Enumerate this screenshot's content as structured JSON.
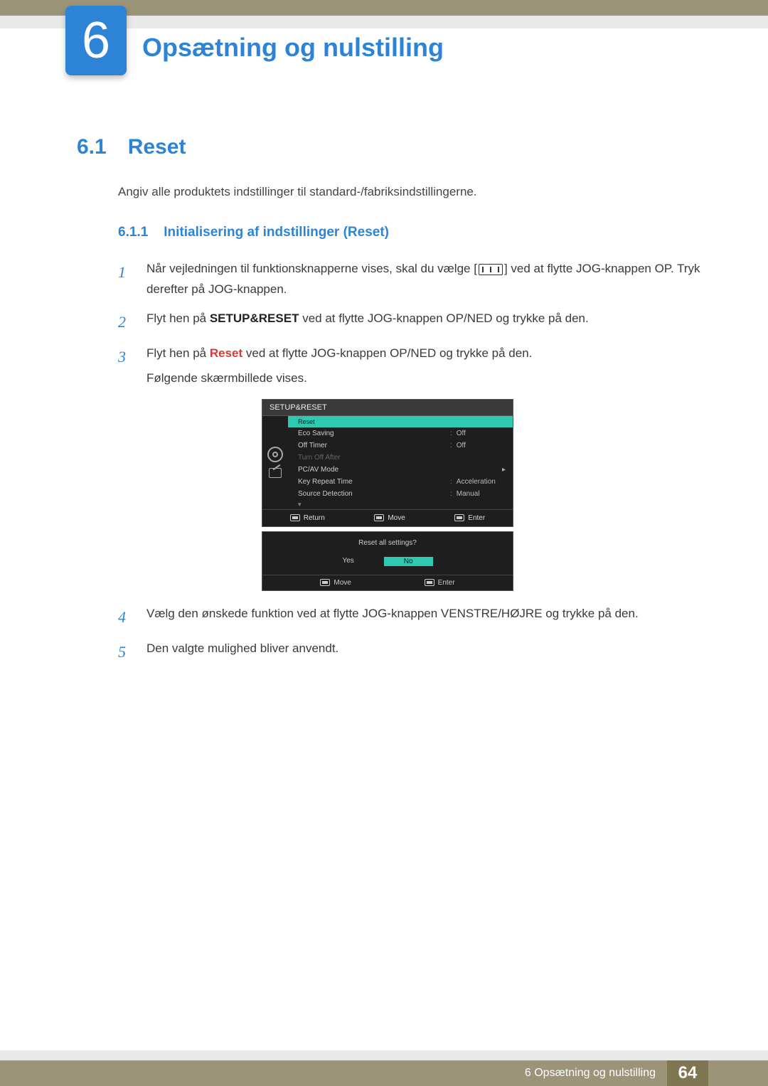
{
  "chapter": {
    "number": "6",
    "title": "Opsætning og nulstilling"
  },
  "section": {
    "number": "6.1",
    "title": "Reset"
  },
  "intro": "Angiv alle produktets indstillinger til standard-/fabriksindstillingerne.",
  "subsection": {
    "number": "6.1.1",
    "title": "Initialisering af indstillinger (Reset)"
  },
  "steps": {
    "s1": {
      "num": "1",
      "pre": "Når vejledningen til funktionsknapperne vises, skal du vælge [",
      "post": "] ved at flytte JOG-knappen OP. Tryk derefter på JOG-knappen."
    },
    "s2": {
      "num": "2",
      "pre": "Flyt hen på ",
      "bold": "SETUP&RESET",
      "post": " ved at flytte JOG-knappen OP/NED og trykke på den."
    },
    "s3": {
      "num": "3",
      "pre": "Flyt hen på ",
      "bold": "Reset",
      "post": " ved at flytte JOG-knappen OP/NED og trykke på den.",
      "tail": "Følgende skærmbillede vises."
    },
    "s4": {
      "num": "4",
      "text": "Vælg den ønskede funktion ved at flytte JOG-knappen VENSTRE/HØJRE og trykke på den."
    },
    "s5": {
      "num": "5",
      "text": "Den valgte mulighed bliver anvendt."
    }
  },
  "osd": {
    "header": "SETUP&RESET",
    "items": [
      {
        "label": "Reset",
        "value": "",
        "selected": true
      },
      {
        "label": "Eco Saving",
        "value": "Off"
      },
      {
        "label": "Off Timer",
        "value": "Off"
      },
      {
        "label": "Turn Off After",
        "value": "",
        "dim": true
      },
      {
        "label": "PC/AV Mode",
        "value": "",
        "arrow": true
      },
      {
        "label": "Key Repeat Time",
        "value": "Acceleration"
      },
      {
        "label": "Source Detection",
        "value": "Manual"
      }
    ],
    "footer": {
      "return": "Return",
      "move": "Move",
      "enter": "Enter"
    }
  },
  "osd2": {
    "question": "Reset all settings?",
    "yes": "Yes",
    "no": "No",
    "move": "Move",
    "enter": "Enter"
  },
  "footer": {
    "text": "6 Opsætning og nulstilling",
    "page": "64"
  }
}
